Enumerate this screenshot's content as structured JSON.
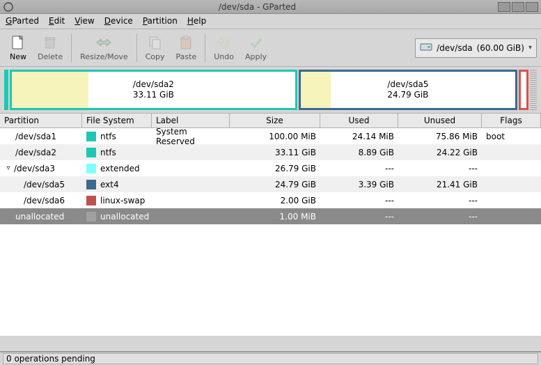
{
  "window": {
    "title": "/dev/sda - GParted"
  },
  "menu": {
    "gparted": "GParted",
    "edit": "Edit",
    "view": "View",
    "device": "Device",
    "partition": "Partition",
    "help": "Help"
  },
  "toolbar": {
    "new": "New",
    "delete": "Delete",
    "resize": "Resize/Move",
    "copy": "Copy",
    "paste": "Paste",
    "undo": "Undo",
    "apply": "Apply"
  },
  "device_selector": {
    "device": "/dev/sda",
    "size": "(60.00 GiB)"
  },
  "visual": {
    "left": {
      "name": "/dev/sda2",
      "size": "33.11 GiB"
    },
    "right": {
      "name": "/dev/sda5",
      "size": "24.79 GiB"
    }
  },
  "columns": {
    "partition": "Partition",
    "filesystem": "File System",
    "label": "Label",
    "size": "Size",
    "used": "Used",
    "unused": "Unused",
    "flags": "Flags"
  },
  "rows": [
    {
      "part": "/dev/sda1",
      "fs": "ntfs",
      "fscolor": "c-ntfs",
      "label": "System Reserved",
      "size": "100.00 MiB",
      "used": "24.14 MiB",
      "unused": "75.86 MiB",
      "flags": "boot",
      "indent": 1
    },
    {
      "part": "/dev/sda2",
      "fs": "ntfs",
      "fscolor": "c-ntfs",
      "label": "",
      "size": "33.11 GiB",
      "used": "8.89 GiB",
      "unused": "24.22 GiB",
      "flags": "",
      "indent": 1
    },
    {
      "part": "/dev/sda3",
      "fs": "extended",
      "fscolor": "c-extended",
      "label": "",
      "size": "26.79 GiB",
      "used": "---",
      "unused": "---",
      "flags": "",
      "indent": 0,
      "expander": true
    },
    {
      "part": "/dev/sda5",
      "fs": "ext4",
      "fscolor": "c-ext4",
      "label": "",
      "size": "24.79 GiB",
      "used": "3.39 GiB",
      "unused": "21.41 GiB",
      "flags": "",
      "indent": 2
    },
    {
      "part": "/dev/sda6",
      "fs": "linux-swap",
      "fscolor": "c-swap",
      "label": "",
      "size": "2.00 GiB",
      "used": "---",
      "unused": "---",
      "flags": "",
      "indent": 2
    },
    {
      "part": "unallocated",
      "fs": "unallocated",
      "fscolor": "c-unalloc",
      "label": "",
      "size": "1.00 MiB",
      "used": "---",
      "unused": "---",
      "flags": "",
      "indent": 1,
      "selected": true
    }
  ],
  "status": "0 operations pending"
}
